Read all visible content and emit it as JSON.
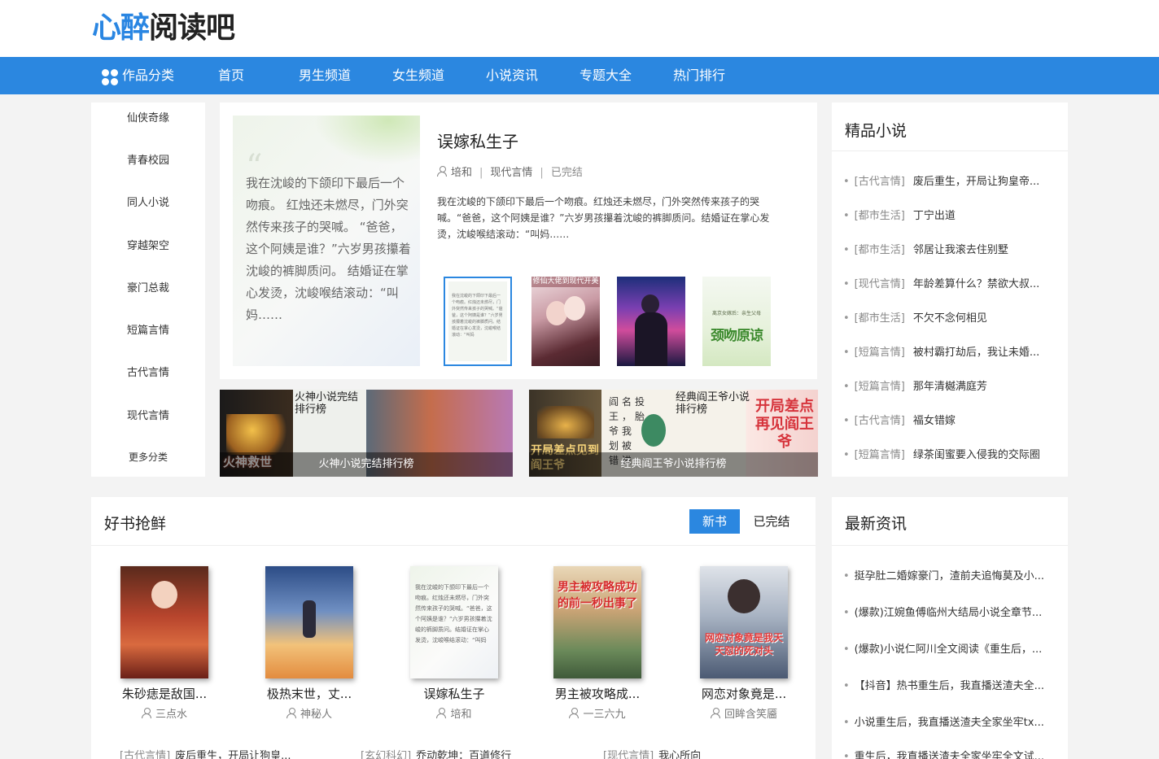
{
  "logo": {
    "part1": "心醉",
    "part2": "阅读吧"
  },
  "nav": {
    "category_label": "作品分类",
    "items": [
      "首页",
      "男生频道",
      "女生频道",
      "小说资讯",
      "专题大全",
      "热门排行"
    ]
  },
  "sidebar": {
    "items": [
      "仙侠奇缘",
      "青春校园",
      "同人小说",
      "穿越架空",
      "豪门总裁",
      "短篇言情",
      "古代言情",
      "现代言情"
    ],
    "more": "更多分类"
  },
  "featured": {
    "cover_text": "我在沈峻的下颌印下最后一个吻痕。 红烛还未燃尽，门外突然传来孩子的哭喊。 “爸爸，这个阿姨是谁？”六岁男孩攥着沈峻的裤脚质问。 结婚证在掌心发烫，沈峻喉结滚动：“叫妈……",
    "title": "误嫁私生子",
    "author": "培和",
    "category": "现代言情",
    "status": "已完结",
    "description": "我在沈峻的下颌印下最后一个吻痕。红烛还未燃尽，门外突然传来孩子的哭喊。“爸爸，这个阿姨是谁？”六岁男孩攥着沈峻的裤脚质问。结婚证在掌心发烫，沈峻喉结滚动：“叫妈……",
    "thumb1_text": "我在沈峻的下颌印下最后一个吻痕。红烛还未燃尽，门外突然传来孩子的哭喊。“爸爸，这个阿姨是谁？”六岁男孩攥着沈峻的裤脚质问。结婚证在掌心发烫，沈峻喉结滚动：“叫妈",
    "thumb2_text": "修仙大佬到现代开美",
    "thumb4_text": "离京女嫁后：亲生父母",
    "thumb4_subtext": "颈吻原谅"
  },
  "banners": [
    {
      "caption": "火神小说完结排行榜",
      "alt": "火神小说完结排行榜",
      "overlay": "火神救世"
    },
    {
      "caption": "经典阎王爷小说排行榜",
      "alt": "经典阎王爷小说排行榜",
      "poem": "阎名投 王，胎 爷我 划被 错进",
      "overlay": "开局差点见到阎王爷",
      "overlay2": "开局差点再见阎王爷"
    }
  ],
  "premium": {
    "title": "精品小说",
    "items": [
      {
        "tag": "[古代言情]",
        "name": "废后重生，开局让狗皇帝..."
      },
      {
        "tag": "[都市生活]",
        "name": "丁宁出道"
      },
      {
        "tag": "[都市生活]",
        "name": "邻居让我滚去住别墅"
      },
      {
        "tag": "[现代言情]",
        "name": "年龄差算什么？禁欲大叔..."
      },
      {
        "tag": "[都市生活]",
        "name": "不欠不念何相见"
      },
      {
        "tag": "[短篇言情]",
        "name": "被村霸打劫后，我让未婚..."
      },
      {
        "tag": "[短篇言情]",
        "name": "那年清樾满庭芳"
      },
      {
        "tag": "[古代言情]",
        "name": "福女错嫁"
      },
      {
        "tag": "[短篇言情]",
        "name": "绿茶闺蜜要入侵我的交际圈"
      }
    ]
  },
  "goodbooks": {
    "title": "好书抢鲜",
    "tabs": [
      "新书",
      "已完结"
    ],
    "books": [
      {
        "name": "朱砂痣是敌国...",
        "author": "三点水"
      },
      {
        "name": "极热末世，丈...",
        "author": "神秘人"
      },
      {
        "name": "误嫁私生子",
        "author": "培和",
        "cover_text": "我在沈峻的下颌印下最后一个吻痕。红烛还未燃尽，门外突然传来孩子的哭喊。“爸爸，这个阿姨是谁？”六岁男孩攥着沈峻的裤脚质问。结婚证在掌心发烫，沈峻喉结滚动：“叫妈"
      },
      {
        "name": "男主被攻略成...",
        "author": "一三六九",
        "cover_text": "男主被攻略成功的前一秒出事了"
      },
      {
        "name": "网恋对象竟是...",
        "author": "回眸含笑靥",
        "cover_text": "网恋对象竟是我天天怼的死对头"
      }
    ],
    "list": [
      {
        "tag": "[古代言情]",
        "name": "废后重生，开局让狗皇..."
      },
      {
        "tag": "[玄幻科幻]",
        "name": "乔动乾坤：百道修行"
      },
      {
        "tag": "[现代言情]",
        "name": "我心所向"
      }
    ]
  },
  "news": {
    "title": "最新资讯",
    "items": [
      "挺孕肚二婚嫁豪门，渣前夫追悔莫及小...",
      "(爆款)江婉鱼傅临州大结局小说全章节...",
      "(爆款)小说仁阿川全文阅读《重生后，...",
      "【抖音】热书重生后，我直播送渣夫全...",
      "小说重生后，我直播送渣夫全家坐牢tx...",
      "重生后，我直播送渣夫全家坐牢全文试..."
    ]
  },
  "colors": {
    "accent": "#2b87e0",
    "logo_blue": "#2a86e2"
  }
}
